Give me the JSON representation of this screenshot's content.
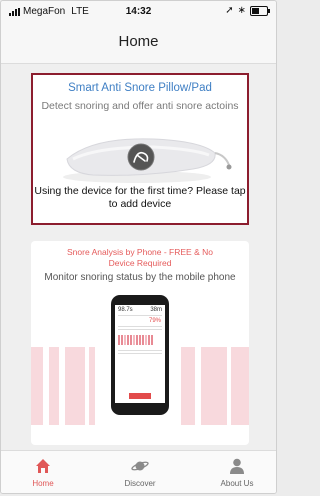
{
  "status_bar": {
    "carrier": "MegaFon",
    "network": "LTE",
    "time": "14:32"
  },
  "header": {
    "title": "Home"
  },
  "device_card": {
    "title": "Smart Anti Snore Pillow/Pad",
    "subtitle": "Detect snoring and offer anti snore actoins",
    "cta_line1": "Using the device for the first time? Please tap",
    "cta_line2": "to add device"
  },
  "phone_card": {
    "title_line1": "Snore Analysis by Phone - FREE & No",
    "title_line2": "Device Required",
    "subtitle": "Monitor snoring status by the mobile phone",
    "screen": {
      "left_value": "98.7s",
      "right_value": "38m",
      "percent": "79%"
    }
  },
  "tabs": [
    {
      "label": "Home",
      "icon": "home-icon",
      "active": true
    },
    {
      "label": "Discover",
      "icon": "planet-icon",
      "active": false
    },
    {
      "label": "About Us",
      "icon": "user-icon",
      "active": false
    }
  ],
  "colors": {
    "accent": "#e05757",
    "title_blue": "#3f7fc4",
    "card_border": "#8c1d2e"
  }
}
